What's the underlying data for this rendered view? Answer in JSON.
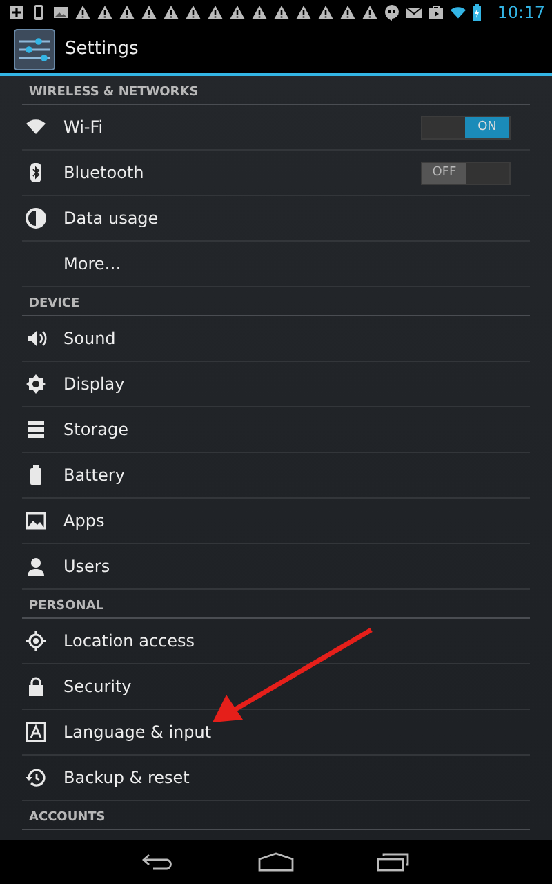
{
  "status_bar": {
    "time": "10:17"
  },
  "action_bar": {
    "title": "Settings"
  },
  "sections": [
    {
      "header": "WIRELESS & NETWORKS",
      "items": [
        {
          "label": "Wi-Fi",
          "kind": "toggle",
          "toggle": {
            "label": "ON",
            "on": true
          }
        },
        {
          "label": "Bluetooth",
          "kind": "toggle",
          "toggle": {
            "label": "OFF",
            "on": false
          }
        },
        {
          "label": "Data usage",
          "kind": "plain"
        },
        {
          "label": "More…",
          "kind": "plain"
        }
      ]
    },
    {
      "header": "DEVICE",
      "items": [
        {
          "label": "Sound",
          "kind": "plain"
        },
        {
          "label": "Display",
          "kind": "plain"
        },
        {
          "label": "Storage",
          "kind": "plain"
        },
        {
          "label": "Battery",
          "kind": "plain"
        },
        {
          "label": "Apps",
          "kind": "plain"
        },
        {
          "label": "Users",
          "kind": "plain"
        }
      ]
    },
    {
      "header": "PERSONAL",
      "items": [
        {
          "label": "Location access",
          "kind": "plain"
        },
        {
          "label": "Security",
          "kind": "plain"
        },
        {
          "label": "Language & input",
          "kind": "plain"
        },
        {
          "label": "Backup & reset",
          "kind": "plain"
        }
      ]
    },
    {
      "header": "ACCOUNTS"
    }
  ]
}
